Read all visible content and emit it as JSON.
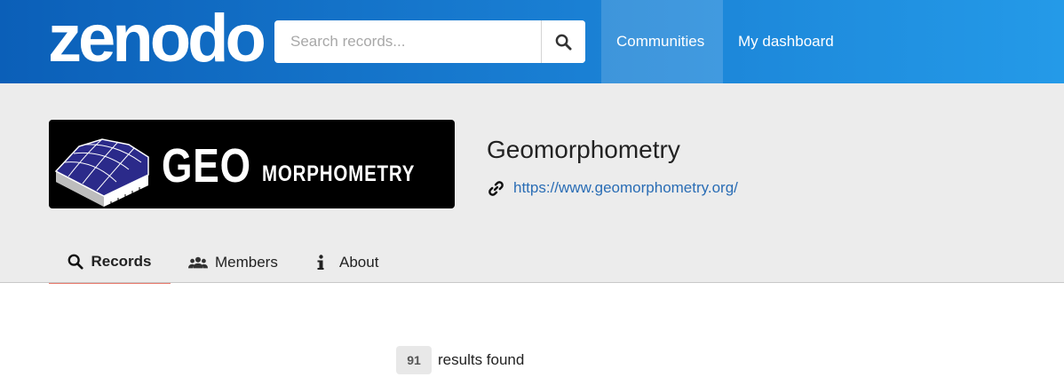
{
  "header": {
    "logo": "zenodo",
    "search": {
      "placeholder": "Search records...",
      "value": "",
      "icon": "search-icon"
    },
    "nav": [
      {
        "label": "Communities",
        "active": true
      },
      {
        "label": "My dashboard",
        "active": false
      }
    ],
    "colors": {
      "gradient_start": "#0b5fb8",
      "gradient_end": "#249ae8"
    }
  },
  "community": {
    "banner": {
      "word1": "GEO",
      "word2": "MORPHOMETRY"
    },
    "title": "Geomorphometry",
    "link_icon": "link-icon",
    "url": "https://www.geomorphometry.org/"
  },
  "tabs": [
    {
      "label": "Records",
      "icon": "search-icon",
      "active": true
    },
    {
      "label": "Members",
      "icon": "users-icon",
      "active": false
    },
    {
      "label": "About",
      "icon": "info-icon",
      "active": false
    }
  ],
  "results": {
    "count": "91",
    "label": "results found"
  },
  "colors": {
    "accent": "#e8776a",
    "link": "#2a6db5",
    "band": "#ececec"
  }
}
